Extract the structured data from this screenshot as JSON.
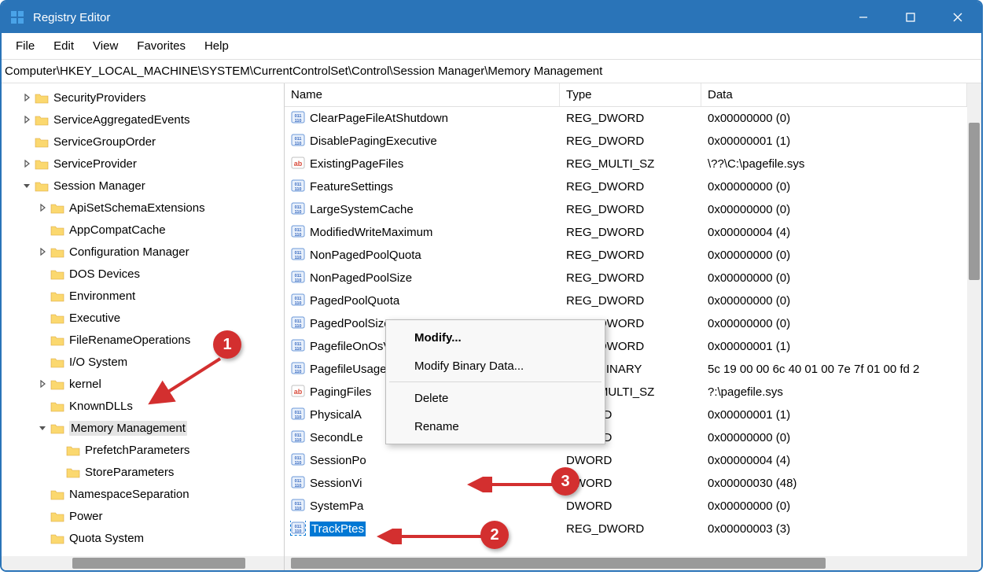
{
  "window": {
    "title": "Registry Editor"
  },
  "menubar": [
    "File",
    "Edit",
    "View",
    "Favorites",
    "Help"
  ],
  "address": "Computer\\HKEY_LOCAL_MACHINE\\SYSTEM\\CurrentControlSet\\Control\\Session Manager\\Memory Management",
  "tree": [
    {
      "depth": 1,
      "tw": "closed",
      "label": "SecurityProviders"
    },
    {
      "depth": 1,
      "tw": "closed",
      "label": "ServiceAggregatedEvents"
    },
    {
      "depth": 1,
      "tw": "none",
      "label": "ServiceGroupOrder"
    },
    {
      "depth": 1,
      "tw": "closed",
      "label": "ServiceProvider"
    },
    {
      "depth": 1,
      "tw": "open",
      "label": "Session Manager"
    },
    {
      "depth": 2,
      "tw": "closed",
      "label": "ApiSetSchemaExtensions"
    },
    {
      "depth": 2,
      "tw": "none",
      "label": "AppCompatCache"
    },
    {
      "depth": 2,
      "tw": "closed",
      "label": "Configuration Manager"
    },
    {
      "depth": 2,
      "tw": "none",
      "label": "DOS Devices"
    },
    {
      "depth": 2,
      "tw": "none",
      "label": "Environment"
    },
    {
      "depth": 2,
      "tw": "none",
      "label": "Executive"
    },
    {
      "depth": 2,
      "tw": "none",
      "label": "FileRenameOperations"
    },
    {
      "depth": 2,
      "tw": "none",
      "label": "I/O System"
    },
    {
      "depth": 2,
      "tw": "closed",
      "label": "kernel"
    },
    {
      "depth": 2,
      "tw": "none",
      "label": "KnownDLLs"
    },
    {
      "depth": 2,
      "tw": "open",
      "label": "Memory Management",
      "selected": true
    },
    {
      "depth": 3,
      "tw": "none",
      "label": "PrefetchParameters"
    },
    {
      "depth": 3,
      "tw": "none",
      "label": "StoreParameters"
    },
    {
      "depth": 2,
      "tw": "none",
      "label": "NamespaceSeparation"
    },
    {
      "depth": 2,
      "tw": "none",
      "label": "Power"
    },
    {
      "depth": 2,
      "tw": "none",
      "label": "Quota System"
    }
  ],
  "columns": {
    "name": "Name",
    "type": "Type",
    "data": "Data"
  },
  "values": [
    {
      "icon": "num",
      "name": "ClearPageFileAtShutdown",
      "type": "REG_DWORD",
      "data": "0x00000000 (0)"
    },
    {
      "icon": "num",
      "name": "DisablePagingExecutive",
      "type": "REG_DWORD",
      "data": "0x00000001 (1)"
    },
    {
      "icon": "str",
      "name": "ExistingPageFiles",
      "type": "REG_MULTI_SZ",
      "data": "\\??\\C:\\pagefile.sys"
    },
    {
      "icon": "num",
      "name": "FeatureSettings",
      "type": "REG_DWORD",
      "data": "0x00000000 (0)"
    },
    {
      "icon": "num",
      "name": "LargeSystemCache",
      "type": "REG_DWORD",
      "data": "0x00000000 (0)"
    },
    {
      "icon": "num",
      "name": "ModifiedWriteMaximum",
      "type": "REG_DWORD",
      "data": "0x00000004 (4)"
    },
    {
      "icon": "num",
      "name": "NonPagedPoolQuota",
      "type": "REG_DWORD",
      "data": "0x00000000 (0)"
    },
    {
      "icon": "num",
      "name": "NonPagedPoolSize",
      "type": "REG_DWORD",
      "data": "0x00000000 (0)"
    },
    {
      "icon": "num",
      "name": "PagedPoolQuota",
      "type": "REG_DWORD",
      "data": "0x00000000 (0)"
    },
    {
      "icon": "num",
      "name": "PagedPoolSize",
      "type": "REG_DWORD",
      "data": "0x00000000 (0)"
    },
    {
      "icon": "num",
      "name": "PagefileOnOsVolume",
      "type": "REG_DWORD",
      "data": "0x00000001 (1)"
    },
    {
      "icon": "num",
      "name": "PagefileUsage",
      "type": "REG_BINARY",
      "data": "5c 19 00 00 6c 40 01 00 7e 7f 01 00 fd 2"
    },
    {
      "icon": "str",
      "name": "PagingFiles",
      "type": "REG_MULTI_SZ",
      "data": "?:\\pagefile.sys"
    },
    {
      "icon": "num",
      "name": "PhysicalA",
      "type": "DWORD",
      "data": "0x00000001 (1)",
      "truncated": true
    },
    {
      "icon": "num",
      "name": "SecondLe",
      "type": "DWORD",
      "data": "0x00000000 (0)",
      "truncated": true
    },
    {
      "icon": "num",
      "name": "SessionPo",
      "type": "DWORD",
      "data": "0x00000004 (4)",
      "truncated": true
    },
    {
      "icon": "num",
      "name": "SessionVi",
      "type": "DWORD",
      "data": "0x00000030 (48)",
      "truncated": true
    },
    {
      "icon": "num",
      "name": "SystemPa",
      "type": "DWORD",
      "data": "0x00000000 (0)",
      "truncated": true
    },
    {
      "icon": "num",
      "name": "TrackPtes",
      "type": "REG_DWORD",
      "data": "0x00000003 (3)",
      "selected": true
    }
  ],
  "contextmenu": {
    "items": [
      "Modify...",
      "Modify Binary Data...",
      "",
      "Delete",
      "Rename"
    ]
  },
  "callouts": {
    "c1": "1",
    "c2": "2",
    "c3": "3"
  }
}
